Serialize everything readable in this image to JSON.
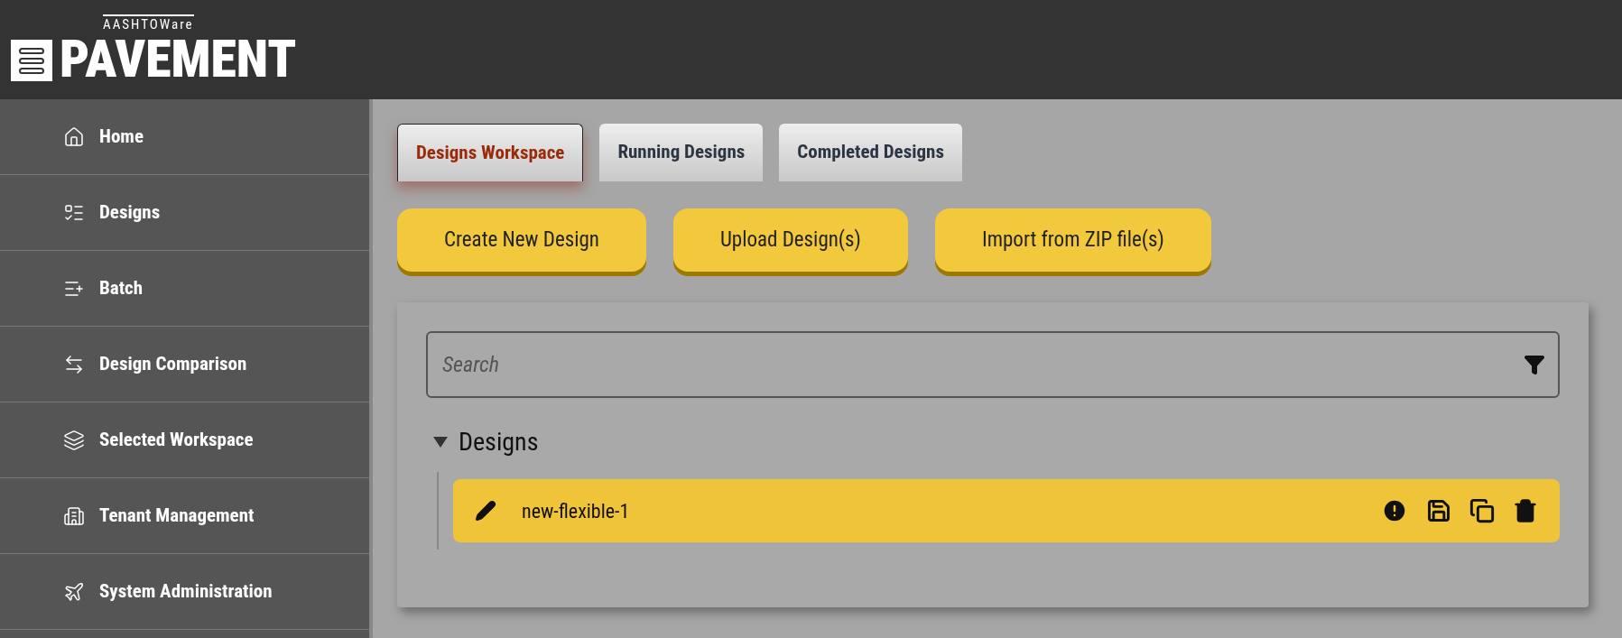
{
  "logo": {
    "brand": "AASHTOWare",
    "product": "PAVEMENT"
  },
  "sidebar": {
    "items": [
      {
        "label": "Home"
      },
      {
        "label": "Designs"
      },
      {
        "label": "Batch"
      },
      {
        "label": "Design Comparison"
      },
      {
        "label": "Selected Workspace"
      },
      {
        "label": "Tenant Management"
      },
      {
        "label": "System Administration"
      }
    ]
  },
  "tabs": [
    {
      "label": "Designs Workspace",
      "selected": true
    },
    {
      "label": "Running Designs",
      "selected": false
    },
    {
      "label": "Completed Designs",
      "selected": false
    }
  ],
  "actions": [
    "Create New Design",
    "Upload Design(s)",
    "Import from ZIP file(s)"
  ],
  "search": {
    "placeholder": "Search"
  },
  "tree": {
    "label": "Designs",
    "expanded": true,
    "children": [
      {
        "label": "new-flexible-1",
        "selected": true
      }
    ]
  }
}
